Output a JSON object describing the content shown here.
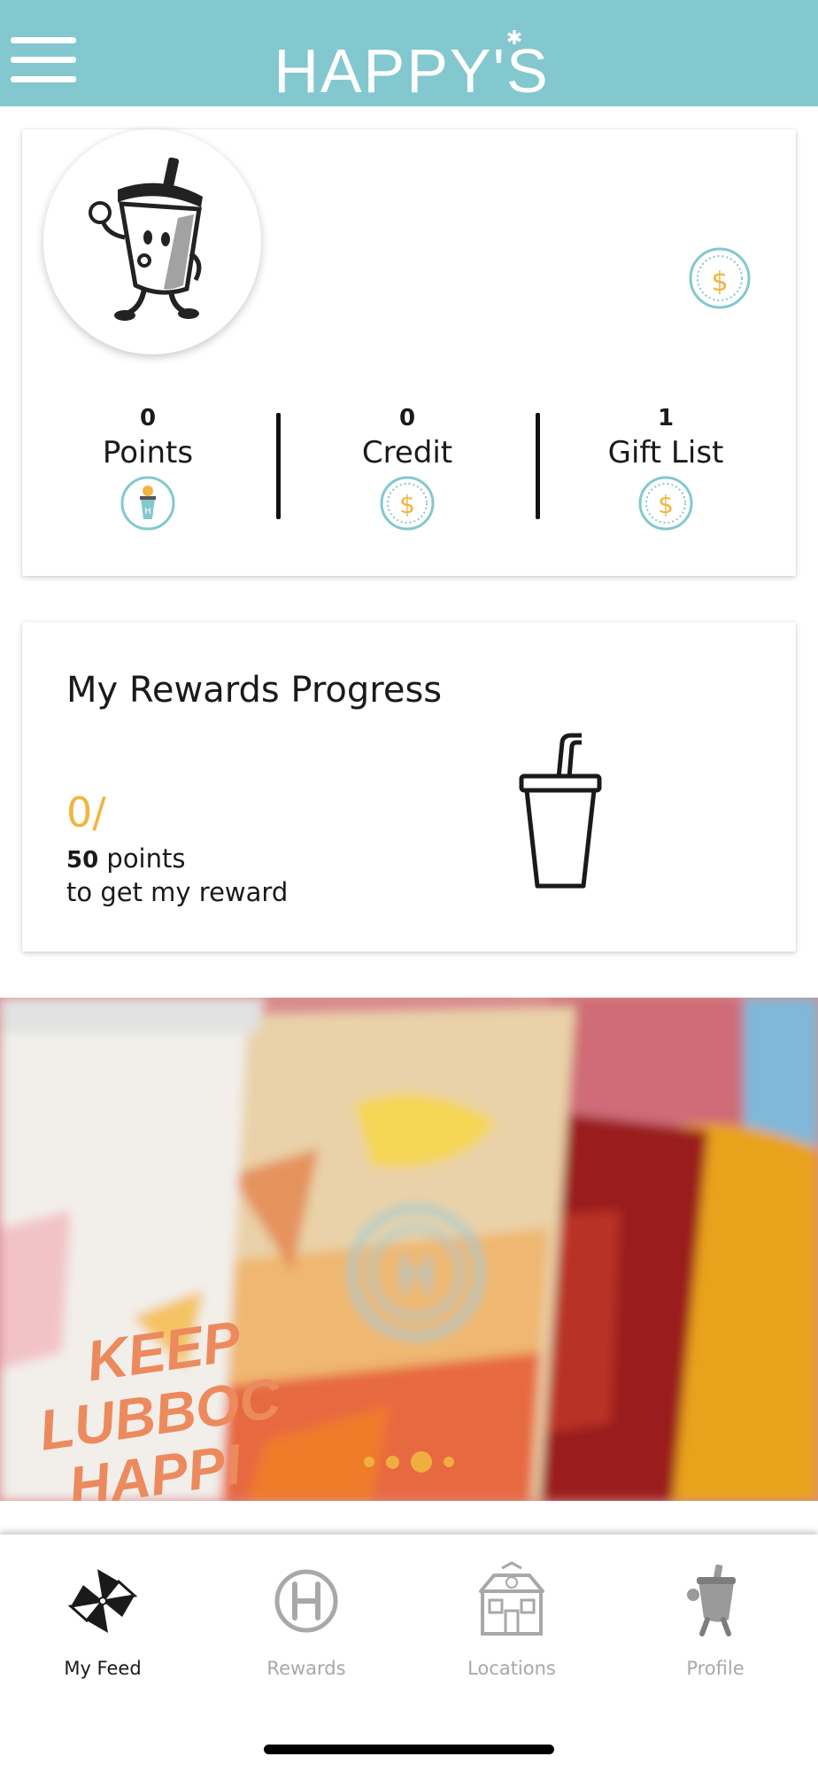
{
  "header": {
    "brand": "HAPPY'S",
    "menu_icon": "hamburger-menu-icon",
    "bg_color": "#83c8ce"
  },
  "stats": {
    "avatar_icon": "cup-mascot-icon",
    "badge_icon": "happys-coin-icon",
    "items": [
      {
        "value": "0",
        "label": "Points",
        "icon": "drink-cup-icon"
      },
      {
        "value": "0",
        "label": "Credit",
        "icon": "dollar-coin-icon"
      },
      {
        "value": "1",
        "label": "Gift List",
        "icon": "dollar-coin-icon"
      }
    ]
  },
  "rewards": {
    "title": "My Rewards Progress",
    "current": "0/",
    "target_number": "50",
    "target_unit": " points",
    "note": "to get my reward",
    "icon": "cup-straw-icon",
    "accent_color": "#f1b540"
  },
  "banner": {
    "text_lines": [
      "KEEP",
      "LUBBOC",
      "HAPPI"
    ],
    "slide_count": 4,
    "active_slide": 3
  },
  "tabs": [
    {
      "label": "My Feed",
      "icon": "pinwheel-icon",
      "active": true
    },
    {
      "label": "Rewards",
      "icon": "h-logo-icon",
      "active": false
    },
    {
      "label": "Locations",
      "icon": "store-icon",
      "active": false
    },
    {
      "label": "Profile",
      "icon": "mascot-profile-icon",
      "active": false
    }
  ]
}
